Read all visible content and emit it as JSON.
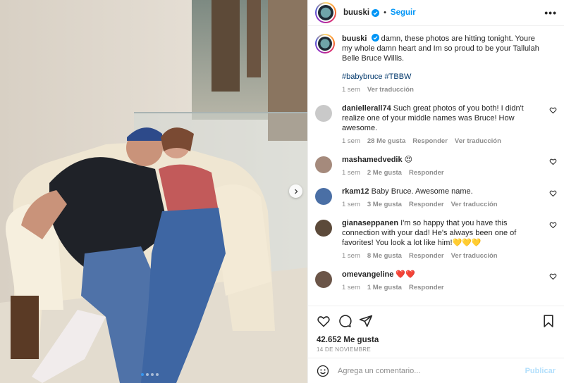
{
  "post": {
    "username": "buuski",
    "follow_label": "Seguir",
    "separator": "•",
    "more_label": "•••"
  },
  "caption": {
    "username": "buuski",
    "text": "damn, these photos are hitting tonight. Youre my whole damn heart and Im so proud to be your Tallulah Belle Bruce Willis.",
    "hashtags": "#babybruce #TBBW",
    "time": "1 sem",
    "translate": "Ver traducción"
  },
  "comments": [
    {
      "username": "daniellerall74",
      "text": "Such great photos of you both! I didn't realize one of your middle names was Bruce! How awesome.",
      "time": "1 sem",
      "likes": "28 Me gusta",
      "reply": "Responder",
      "translate": "Ver traducción",
      "avatar_color": "#c9c9c9"
    },
    {
      "username": "mashamedvedik",
      "text": "😍",
      "time": "1 sem",
      "likes": "2 Me gusta",
      "reply": "Responder",
      "translate": "",
      "avatar_color": "#a58a7c"
    },
    {
      "username": "rkam12",
      "text": "Baby Bruce. Awesome name.",
      "time": "1 sem",
      "likes": "3 Me gusta",
      "reply": "Responder",
      "translate": "Ver traducción",
      "avatar_color": "#4a6fa5"
    },
    {
      "username": "gianaseppanen",
      "text": "I'm so happy that you have this connection with your dad! He's always been one of favorites! You look a lot like him!💛💛💛",
      "time": "1 sem",
      "likes": "8 Me gusta",
      "reply": "Responder",
      "translate": "Ver traducción",
      "avatar_color": "#5c4a3a"
    },
    {
      "username": "omevangeline",
      "text": "❤️❤️",
      "time": "1 sem",
      "likes": "1 Me gusta",
      "reply": "Responder",
      "translate": "",
      "avatar_color": "#6b5548"
    }
  ],
  "footer": {
    "likes": "42.652 Me gusta",
    "date": "14 DE NOVIEMBRE",
    "comment_placeholder": "Agrega un comentario...",
    "post_label": "Publicar"
  },
  "carousel": {
    "total": 4,
    "active": 0
  },
  "icons": [
    "verified-icon",
    "more-icon",
    "heart-icon",
    "comment-icon",
    "share-icon",
    "bookmark-icon",
    "emoji-icon",
    "chevron-right-icon"
  ],
  "colors": {
    "accent": "#0095f6",
    "muted": "#8e8e8e",
    "hashtag": "#00376b",
    "publish_disabled": "#b2dffc"
  }
}
